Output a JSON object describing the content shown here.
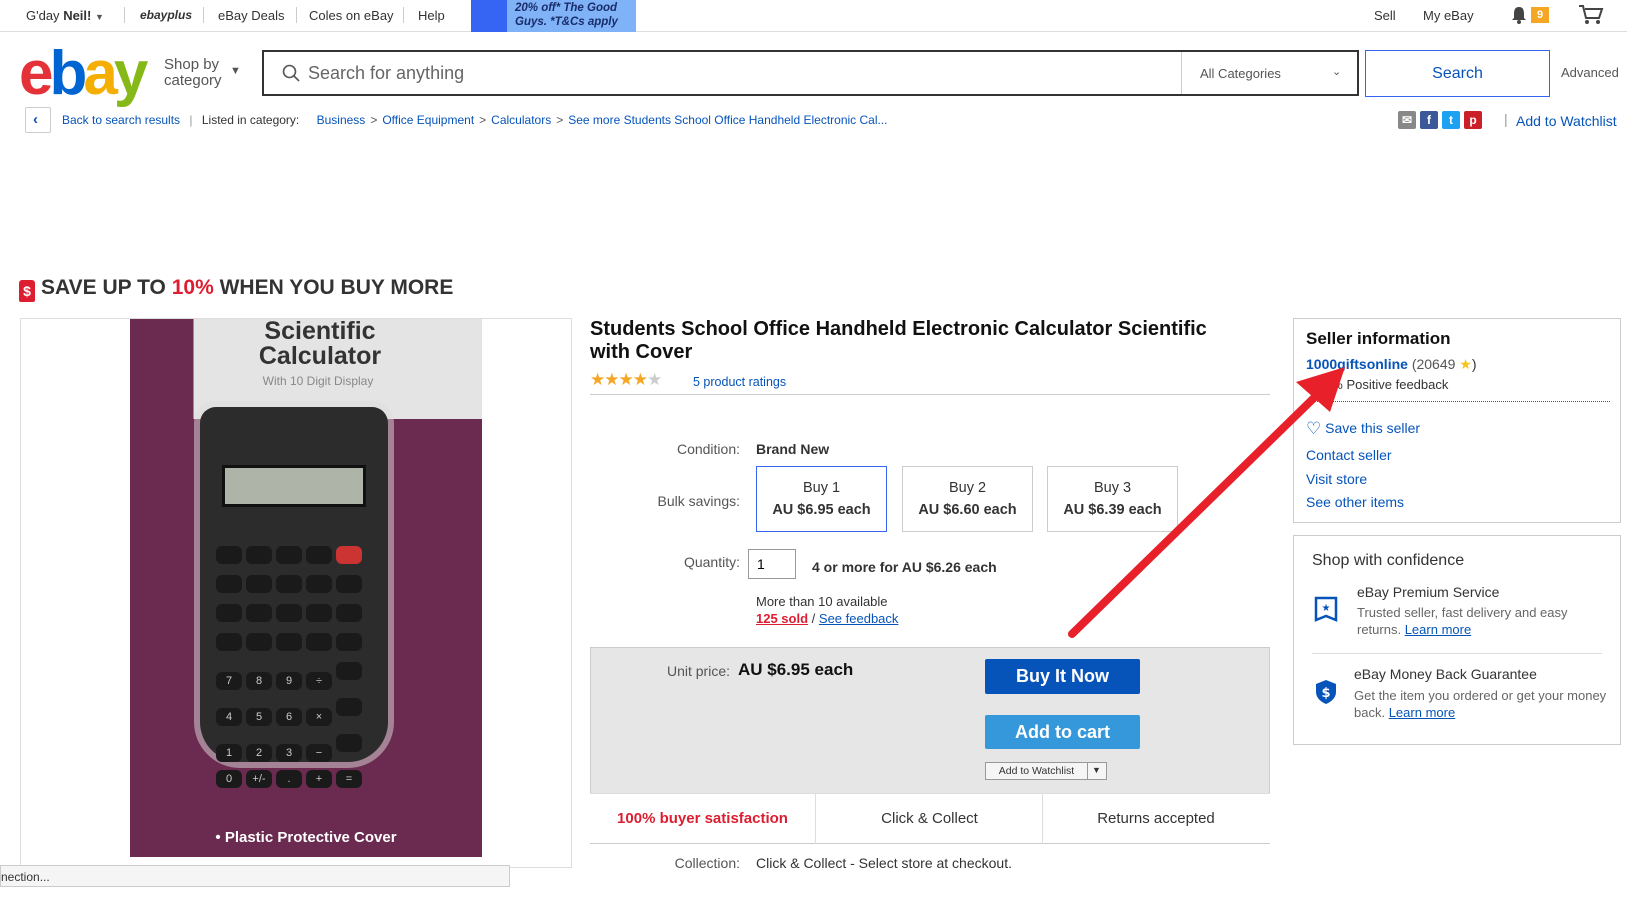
{
  "topbar": {
    "greeting": "G'day",
    "user": "Neil!",
    "ebayplus": "ebayplus",
    "links": [
      "eBay Deals",
      "Coles on eBay",
      "Help"
    ],
    "promo_line1": "20% off* The Good",
    "promo_line2": "Guys. *T&Cs apply",
    "sell": "Sell",
    "my_ebay": "My eBay",
    "notif_count": "9"
  },
  "header": {
    "shop_by_1": "Shop by",
    "shop_by_2": "category",
    "search_placeholder": "Search for anything",
    "category": "All Categories",
    "search_button": "Search",
    "advanced": "Advanced"
  },
  "breadcrumb": {
    "back": "Back to search results",
    "listed_in": "Listed in category:",
    "items": [
      "Business",
      "Office Equipment",
      "Calculators",
      "See more Students School Office Handheld Electronic Cal..."
    ],
    "add_to_watchlist": "Add to Watchlist"
  },
  "save_banner": {
    "pre": "SAVE UP TO",
    "pct": "10%",
    "post": "WHEN YOU BUY MORE"
  },
  "image": {
    "title_1": "Scientific",
    "title_2": "Calculator",
    "subtitle": "With 10 Digit Display",
    "footer": "• Plastic Protective Cover"
  },
  "product": {
    "title": "Students School Office Handheld Electronic Calculator Scientific with Cover",
    "rating": 4,
    "ratings_text": "5 product ratings",
    "condition_label": "Condition:",
    "condition": "Brand New",
    "bulk_label": "Bulk savings:",
    "bulk": [
      {
        "qty": "Buy 1",
        "price": "AU $6.95 each"
      },
      {
        "qty": "Buy 2",
        "price": "AU $6.60 each"
      },
      {
        "qty": "Buy 3",
        "price": "AU $6.39 each"
      }
    ],
    "quantity_label": "Quantity:",
    "quantity": "1",
    "quantity_offer": "4 or more for AU $6.26 each",
    "available": "More than 10 available",
    "sold": "125 sold",
    "slash": "/",
    "see_feedback": "See feedback",
    "unit_price_label": "Unit price:",
    "unit_price": "AU $6.95 each",
    "buy_it_now": "Buy It Now",
    "add_to_cart": "Add to cart",
    "add_to_watchlist": "Add to Watchlist",
    "trust": [
      "100% buyer satisfaction",
      "Click & Collect",
      "Returns accepted"
    ],
    "collection_label": "Collection:",
    "collection": "Click & Collect - Select store at checkout."
  },
  "seller": {
    "heading": "Seller information",
    "name": "1000giftsonline",
    "score": "(20649",
    "close_paren": ")",
    "feedback": "99.9% Positive feedback",
    "save": "Save this seller",
    "contact": "Contact seller",
    "visit": "Visit store",
    "other": "See other items"
  },
  "confidence": {
    "heading": "Shop with confidence",
    "premium_title": "eBay Premium Service",
    "premium_text": "Trusted seller, fast delivery and easy returns.",
    "premium_link": "Learn more",
    "mbg_title": "eBay Money Back Guarantee",
    "mbg_text": "Get the item you ordered or get your money back.",
    "mbg_link": "Learn more"
  },
  "statusbar": {
    "text": "nection..."
  },
  "colors": {
    "link": "#0654ba",
    "accent_red": "#dd1e31",
    "arrow": "#e8202a"
  }
}
